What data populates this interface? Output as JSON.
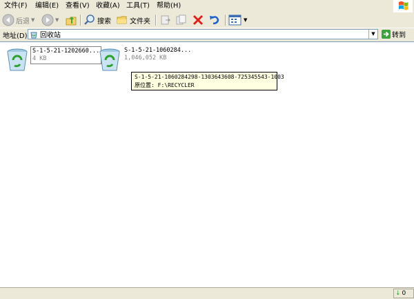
{
  "menu": [
    {
      "label": "文件(F)"
    },
    {
      "label": "编辑(E)"
    },
    {
      "label": "查看(V)"
    },
    {
      "label": "收藏(A)"
    },
    {
      "label": "工具(T)"
    },
    {
      "label": "帮助(H)"
    }
  ],
  "toolbar": {
    "back_label": "后退",
    "search_label": "搜索",
    "folders_label": "文件夹"
  },
  "address": {
    "label": "地址(D)",
    "value": "回收站",
    "go_label": "转到"
  },
  "files": [
    {
      "name": "S-1-5-21-1202660...",
      "size": "4 KB"
    },
    {
      "name": "S-1-5-21-1060284...",
      "size": "1,046,052 KB"
    }
  ],
  "tooltip": {
    "line1": "S-1-5-21-1060284298-1303643608-725345543-1003",
    "line2": "原位置: F:\\RECYCLER"
  },
  "status": {
    "right_text": "0"
  },
  "colors": {
    "bg": "#ECE9D8",
    "tooltip_bg": "#FFFFE1",
    "accent_blue": "#316AC5"
  },
  "icons": [
    "back-icon",
    "forward-icon",
    "up-folder-icon",
    "search-icon",
    "folders-icon",
    "move-to-icon",
    "copy-to-icon",
    "delete-icon",
    "undo-icon",
    "views-icon",
    "recycle-bin-icon",
    "go-arrow-icon",
    "windows-logo-icon"
  ]
}
